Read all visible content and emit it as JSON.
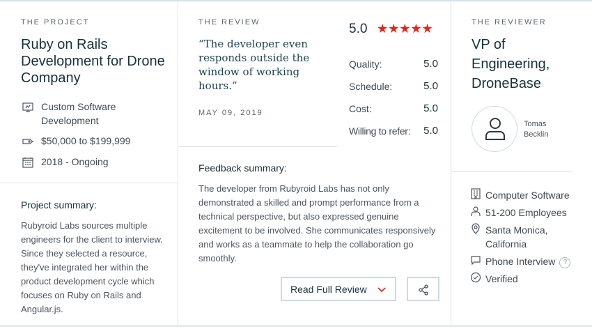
{
  "project": {
    "section_label": "THE PROJECT",
    "title": "Ruby on Rails Development for Drone Company",
    "service": "Custom Software Development",
    "budget": "$50,000 to $199,999",
    "timeline": "2018 - Ongoing",
    "summary_label": "Project summary:",
    "summary_text": "Rubyroid Labs sources multiple engineers for the client to interview. Since they selected a resource, they've integrated her within the product development cycle which focuses on Ruby on Rails and Angular.js."
  },
  "review": {
    "section_label": "THE REVIEW",
    "quote": "“The developer even responds outside the window of working hours.”",
    "date": "MAY 09, 2019",
    "overall_score": "5.0",
    "stars": "★★★★★",
    "star_rating": 5,
    "scores": [
      {
        "label": "Quality:",
        "value": "5.0"
      },
      {
        "label": "Schedule:",
        "value": "5.0"
      },
      {
        "label": "Cost:",
        "value": "5.0"
      },
      {
        "label": "Willing to refer:",
        "value": "5.0"
      }
    ],
    "feedback_label": "Feedback summary:",
    "feedback_text": "The developer from Rubyroid Labs has not only demonstrated a skilled and prompt performance from a technical perspective, but also expressed genuine excitement to be involved. She communicates responsively and works as a teammate to help the collaboration go smoothly.",
    "read_full_label": "Read Full Review"
  },
  "reviewer": {
    "section_label": "THE REVIEWER",
    "title": "VP of Engineering, DroneBase",
    "name": "Tomas Becklin",
    "industry": "Computer Software",
    "employees": "51-200 Employees",
    "location": "Santa Monica, California",
    "interview_type": "Phone Interview",
    "help": "?",
    "status": "Verified"
  },
  "colors": {
    "accent_red": "#e62415",
    "border": "#d6e2e8",
    "heading": "#17313b"
  },
  "icons": [
    "monitor-icon",
    "price-tag-icon",
    "calendar-icon",
    "chevron-down-icon",
    "share-icon",
    "user-icon",
    "building-icon",
    "people-icon",
    "location-pin-icon",
    "chat-bubble-icon",
    "help-icon",
    "check-circle-icon"
  ]
}
